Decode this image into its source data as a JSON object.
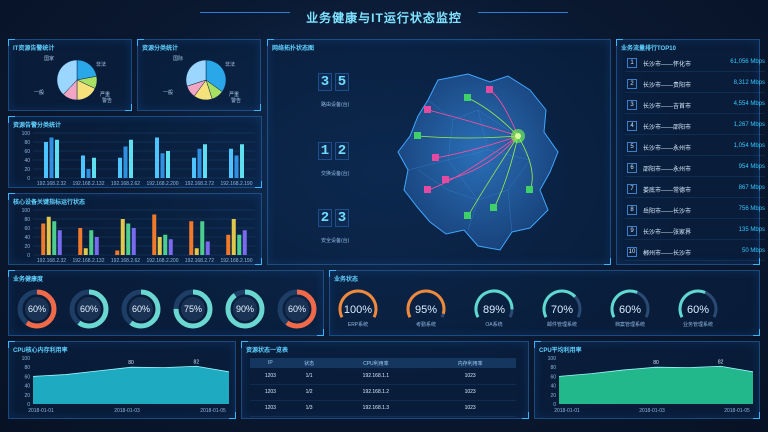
{
  "header": {
    "title": "业务健康与IT运行状态监控"
  },
  "it_stats": {
    "title": "IT资源告警统计",
    "labels": [
      "国家",
      "非法",
      "一般",
      "严重",
      "警告"
    ],
    "values": [
      22,
      10,
      18,
      12,
      38
    ],
    "colors": [
      "#2aa7e8",
      "#a8e064",
      "#f6e27a",
      "#f2a6c4",
      "#9ad6ff"
    ]
  },
  "res_stats": {
    "title": "资源分类统计",
    "labels": [
      "国际",
      "非法",
      "一般",
      "严重",
      "警告"
    ],
    "values": [
      35,
      10,
      15,
      10,
      30
    ],
    "colors": [
      "#2aa7e8",
      "#a8e064",
      "#f6e27a",
      "#f2a6c4",
      "#9ad6ff"
    ]
  },
  "chart_data": [
    {
      "type": "bar",
      "title": "资源告警分类统计",
      "categories": [
        "192.168.2.32",
        "192.168.2.132",
        "192.168.2.62",
        "192.168.2.200",
        "192.168.2.72",
        "192.168.2.190"
      ],
      "series": [
        {
          "values": [
            80,
            50,
            45,
            90,
            45,
            65
          ],
          "color": "#4dc3ff"
        },
        {
          "values": [
            90,
            20,
            70,
            55,
            65,
            50
          ],
          "color": "#2f8fe0"
        },
        {
          "values": [
            85,
            45,
            85,
            60,
            75,
            75
          ],
          "color": "#5fe0f0"
        }
      ],
      "ylim": [
        0,
        100
      ],
      "yticks": [
        0,
        20,
        40,
        60,
        80,
        100
      ]
    },
    {
      "type": "bar",
      "title": "核心设备关键指标运行状态",
      "categories": [
        "192.168.2.32",
        "192.168.2.132",
        "192.168.2.62",
        "192.168.2.200",
        "192.168.2.72",
        "192.168.2.190"
      ],
      "series": [
        {
          "values": [
            70,
            60,
            10,
            90,
            75,
            45
          ],
          "color": "#f07a2a"
        },
        {
          "values": [
            85,
            15,
            80,
            40,
            15,
            80
          ],
          "color": "#e2c84a"
        },
        {
          "values": [
            75,
            55,
            70,
            45,
            75,
            45
          ],
          "color": "#4ccf8e"
        },
        {
          "values": [
            55,
            40,
            60,
            35,
            30,
            55
          ],
          "color": "#7a6af0"
        }
      ],
      "ylim": [
        0,
        100
      ],
      "yticks": [
        0,
        20,
        40,
        60,
        80,
        100
      ]
    },
    {
      "type": "area",
      "title": "CPU核心内存利用率",
      "x": [
        "2018-01-01",
        "2018-01-03",
        "2018-01-05"
      ],
      "x_points": [
        0,
        1,
        2,
        3,
        4,
        5,
        6
      ],
      "values": [
        60,
        64,
        72,
        80,
        79,
        82,
        70
      ],
      "labeled_points": [
        {
          "index": 3,
          "value": 80
        },
        {
          "index": 5,
          "value": 82
        }
      ],
      "ylim": [
        0,
        100
      ],
      "yticks": [
        0,
        20,
        40,
        60,
        80,
        100
      ],
      "color": "#22c3d8"
    },
    {
      "type": "area",
      "title": "CPU平均利用率",
      "x": [
        "2018-01-01",
        "2018-01-03",
        "2018-01-05"
      ],
      "x_points": [
        0,
        1,
        2,
        3,
        4,
        5,
        6
      ],
      "values": [
        60,
        66,
        74,
        80,
        79,
        82,
        70
      ],
      "labeled_points": [
        {
          "index": 3,
          "value": 80
        },
        {
          "index": 5,
          "value": 82
        }
      ],
      "ylim": [
        0,
        100
      ],
      "yticks": [
        0,
        20,
        40,
        60,
        80,
        100
      ],
      "color": "#28d49a"
    }
  ],
  "map": {
    "title": "网络拓扑状态图",
    "counters": [
      {
        "digits": [
          "3",
          "5"
        ],
        "label": "路由设备(台)"
      },
      {
        "digits": [
          "1",
          "2"
        ],
        "label": "交换设备(台)"
      },
      {
        "digits": [
          "2",
          "3"
        ],
        "label": "安全设备(台)"
      }
    ]
  },
  "ranking": {
    "title": "业务流量排行TOP10",
    "rows": [
      {
        "no": "1",
        "route": "长沙市——怀化市",
        "value": "61,056 Mbps"
      },
      {
        "no": "2",
        "route": "长沙市——贵阳市",
        "value": "8,312 Mbps"
      },
      {
        "no": "3",
        "route": "长沙市——吉首市",
        "value": "4,554 Mbps"
      },
      {
        "no": "4",
        "route": "长沙市——邵阳市",
        "value": "1,267 Mbps"
      },
      {
        "no": "5",
        "route": "长沙市——永州市",
        "value": "1,054 Mbps"
      },
      {
        "no": "6",
        "route": "邵阳市——永州市",
        "value": "954 Mbps"
      },
      {
        "no": "7",
        "route": "娄底市——常德市",
        "value": "867 Mbps"
      },
      {
        "no": "8",
        "route": "岳阳市——长沙市",
        "value": "756 Mbps"
      },
      {
        "no": "9",
        "route": "长沙市——张家界",
        "value": "135 Mbps"
      },
      {
        "no": "10",
        "route": "郴州市——长沙市",
        "value": "50 Mbps"
      }
    ]
  },
  "health": {
    "title": "业务健康度",
    "rings": [
      {
        "value": 60,
        "label": "60%",
        "color": "#f06a4a"
      },
      {
        "value": 60,
        "label": "60%",
        "color": "#6ad8d0"
      },
      {
        "value": 60,
        "label": "60%",
        "color": "#6ad8d0"
      },
      {
        "value": 75,
        "label": "75%",
        "color": "#6ad8d0"
      },
      {
        "value": 90,
        "label": "90%",
        "color": "#6ad8d0"
      },
      {
        "value": 60,
        "label": "60%",
        "color": "#f06a4a"
      }
    ]
  },
  "biz_status": {
    "title": "业务状态",
    "gauges": [
      {
        "value": 100,
        "label": "100%",
        "name": "ERP系统",
        "color": "#f08a3a"
      },
      {
        "value": 95,
        "label": "95%",
        "name": "考勤系统",
        "color": "#f08a3a"
      },
      {
        "value": 89,
        "label": "89%",
        "name": "OA系统",
        "color": "#5fd8d0"
      },
      {
        "value": 70,
        "label": "70%",
        "name": "邮件管理系统",
        "color": "#5fd8d0"
      },
      {
        "value": 60,
        "label": "60%",
        "name": "档案管理系统",
        "color": "#5fd8d0"
      },
      {
        "value": 60,
        "label": "60%",
        "name": "业务管理系统",
        "color": "#5fd8d0"
      }
    ]
  },
  "resource_table": {
    "title": "资源状态一览表",
    "columns": [
      "IP",
      "状态",
      "CPU利用率",
      "内存利用率"
    ],
    "rows": [
      [
        "1203",
        "1/1",
        "192.168.1.1",
        "1023"
      ],
      [
        "1203",
        "1/2",
        "192.168.1.2",
        "1023"
      ],
      [
        "1203",
        "1/3",
        "192.168.1.3",
        "1023"
      ]
    ]
  }
}
